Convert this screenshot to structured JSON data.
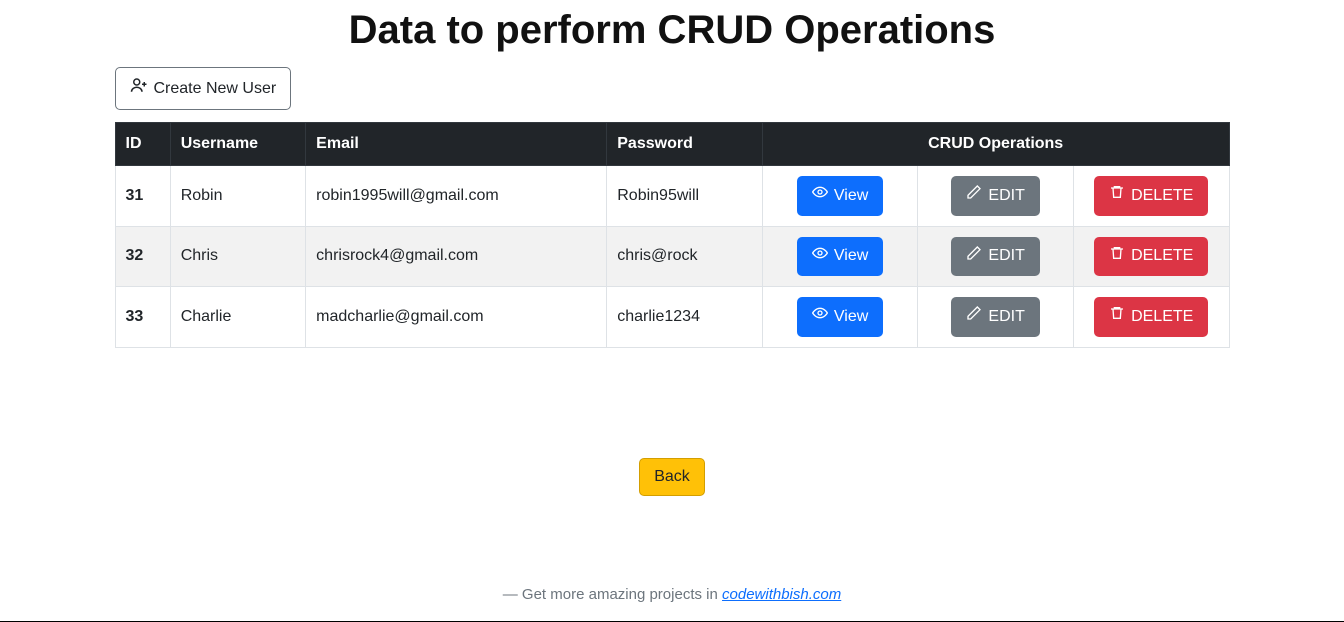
{
  "title": "Data to perform CRUD Operations",
  "create_button": "Create New User",
  "columns": {
    "id": "ID",
    "username": "Username",
    "email": "Email",
    "password": "Password",
    "ops": "CRUD Operations"
  },
  "actions": {
    "view": "View",
    "edit": "EDIT",
    "delete": "DELETE"
  },
  "rows": [
    {
      "id": "31",
      "username": "Robin",
      "email": "robin1995will@gmail.com",
      "password": "Robin95will"
    },
    {
      "id": "32",
      "username": "Chris",
      "email": "chrisrock4@gmail.com",
      "password": "chris@rock"
    },
    {
      "id": "33",
      "username": "Charlie",
      "email": "madcharlie@gmail.com",
      "password": "charlie1234"
    }
  ],
  "back_button": "Back",
  "footer": {
    "prefix": "— Get more amazing projects in ",
    "link_text": "codewithbish.com"
  }
}
